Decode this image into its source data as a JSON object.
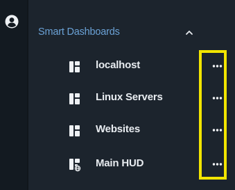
{
  "sidebar": {
    "section": {
      "title": "Smart Dashboards",
      "collapse_icon": "chevron-up-icon"
    },
    "items": [
      {
        "label": "localhost",
        "icon": "dashboard-icon",
        "more_icon": "ellipsis-icon"
      },
      {
        "label": "Linux Servers",
        "icon": "dashboard-icon",
        "more_icon": "ellipsis-icon"
      },
      {
        "label": "Websites",
        "icon": "dashboard-icon",
        "more_icon": "ellipsis-icon"
      },
      {
        "label": "Main HUD",
        "icon": "dashboard-globe-icon",
        "more_icon": "ellipsis-icon"
      }
    ]
  },
  "rail": {
    "user_icon": "user-circle-icon"
  },
  "colors": {
    "background": "#1c242d",
    "rail": "#131a21",
    "section_title": "#6ba2d6",
    "item_text": "#e8ecf0",
    "highlight": "#f2e500"
  }
}
